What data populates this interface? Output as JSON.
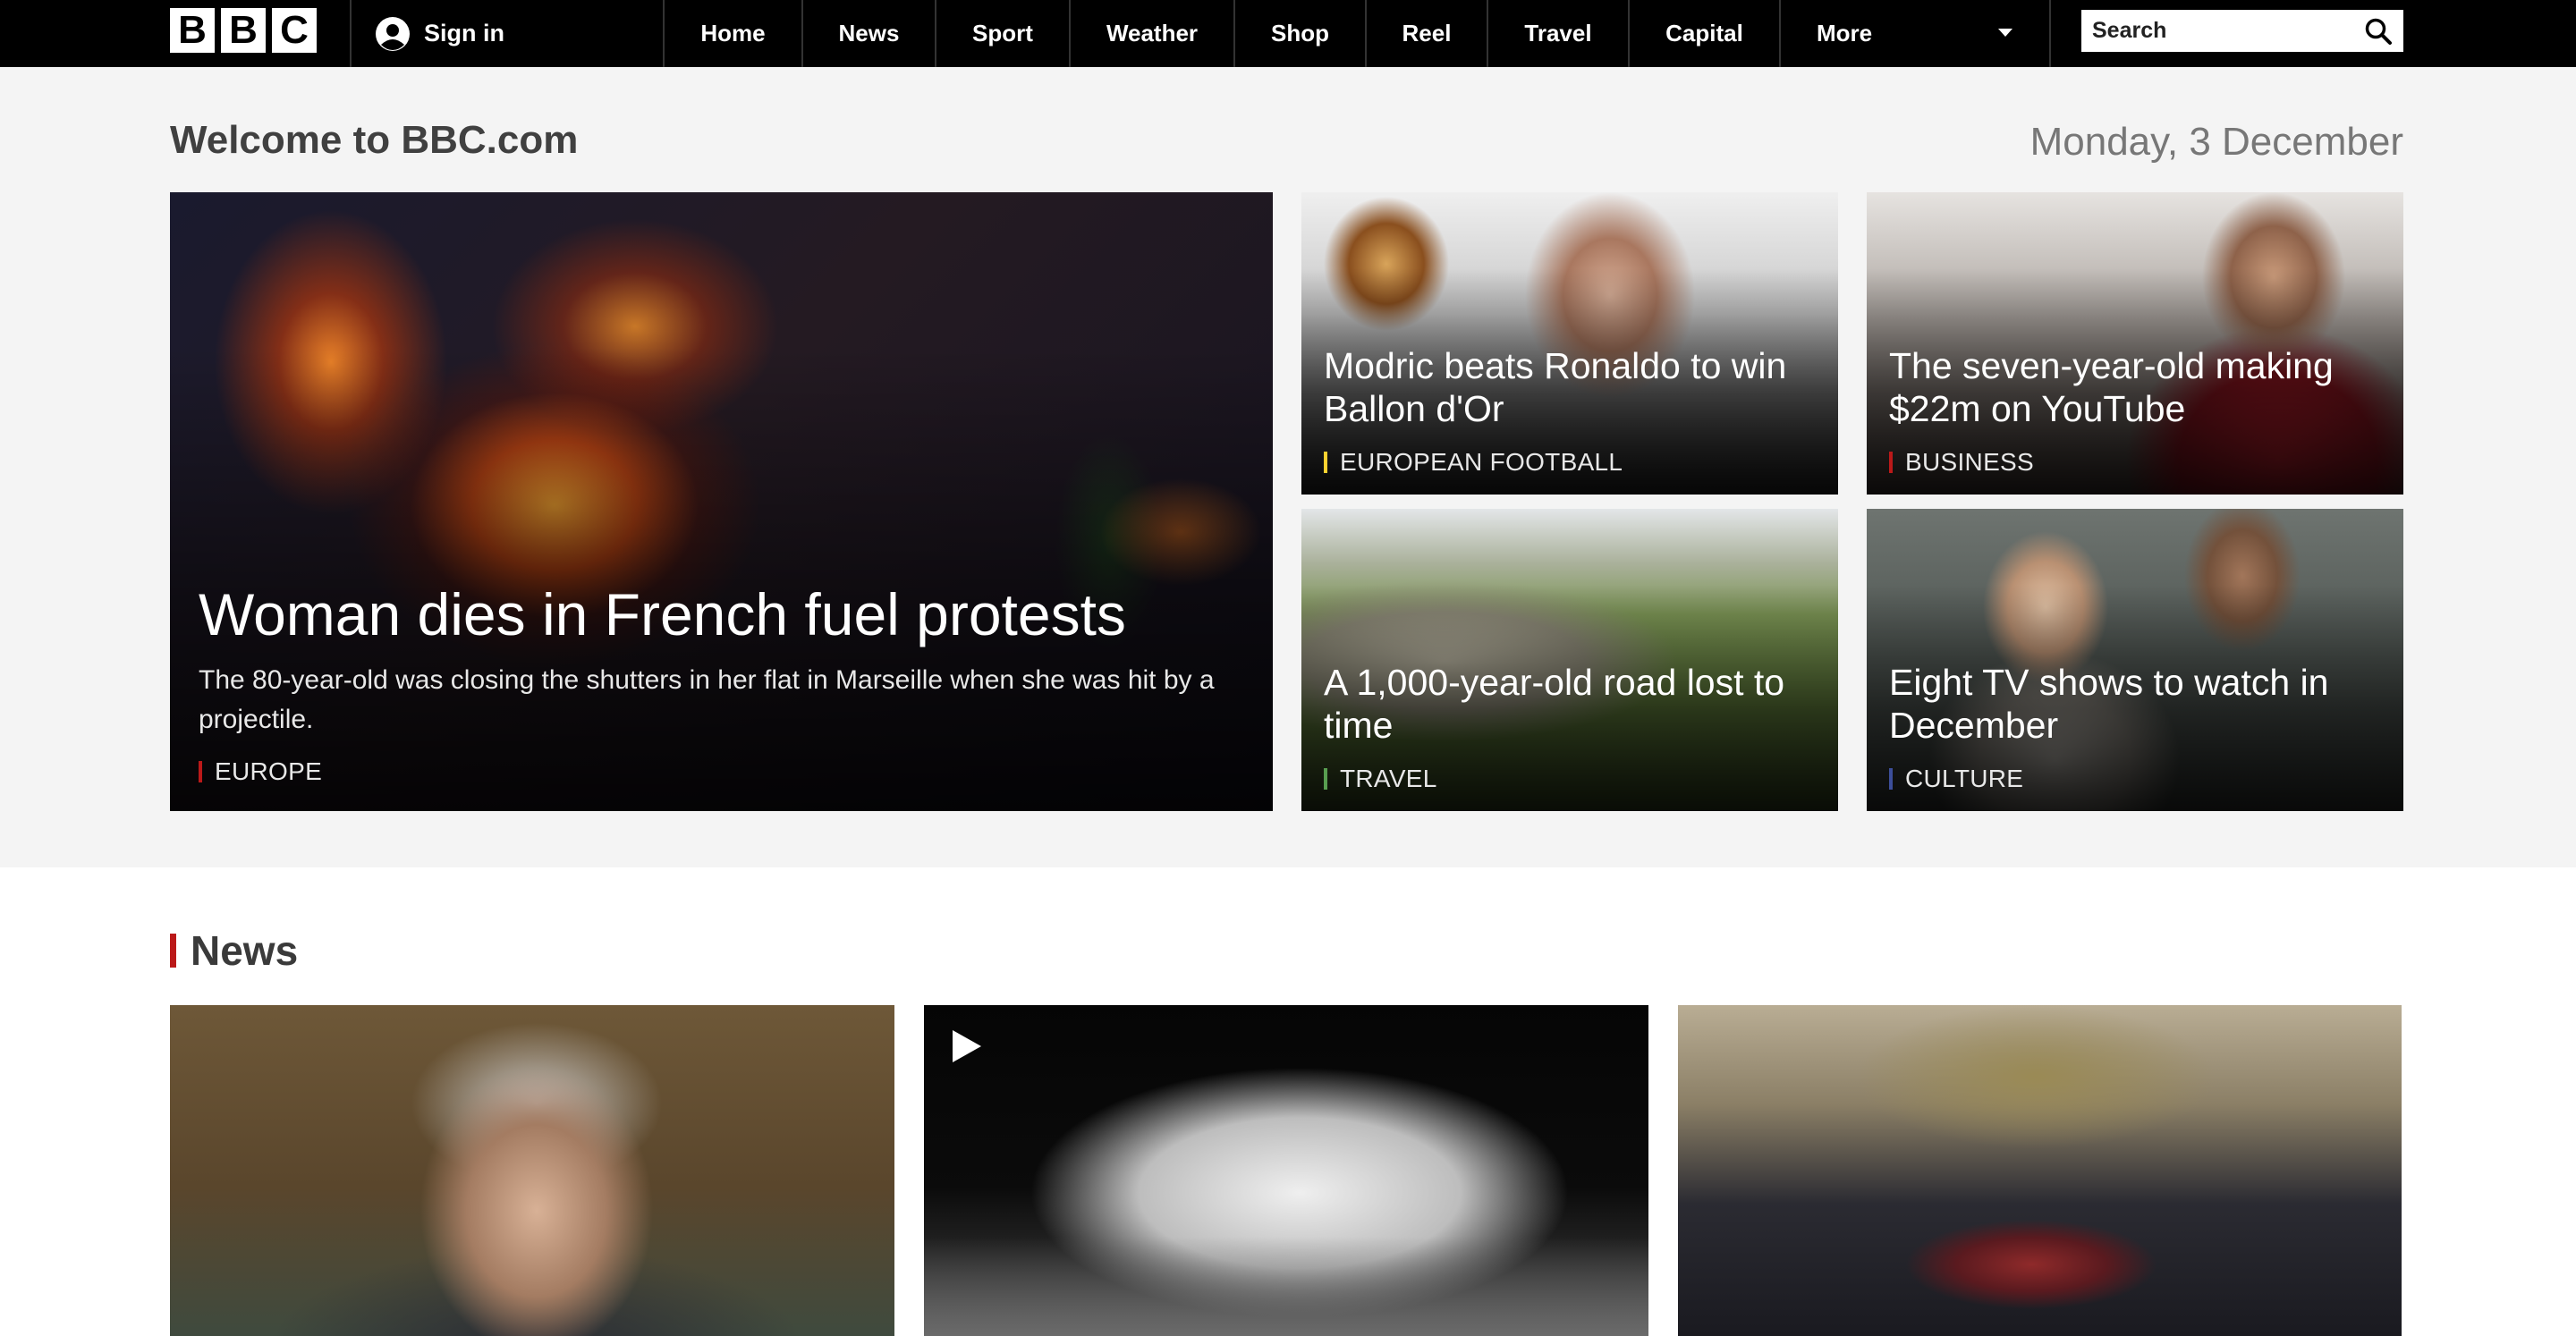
{
  "topbar": {
    "logo_letters": [
      "B",
      "B",
      "C"
    ],
    "signin_label": "Sign in",
    "nav": [
      "Home",
      "News",
      "Sport",
      "Weather",
      "Shop",
      "Reel",
      "Travel",
      "Capital",
      "More"
    ],
    "search_placeholder": "Search",
    "icons": {
      "avatar": "user-avatar-icon",
      "more": "chevron-down-icon",
      "search": "search-icon"
    }
  },
  "welcome": {
    "title": "Welcome to BBC.com",
    "date": "Monday, 3 December"
  },
  "hero": {
    "main": {
      "title": "Woman dies in French fuel protests",
      "summary": "The 80-year-old was closing the shutters in her flat in Marseille when she was hit by a projectile.",
      "tag": "EUROPE",
      "tag_color": "#bb1919"
    },
    "cards": [
      {
        "title": "Modric beats Ronaldo to win Ballon d'Or",
        "tag": "EUROPEAN FOOTBALL",
        "tag_color": "#ffd230"
      },
      {
        "title": "The seven-year-old making $22m on YouTube",
        "tag": "BUSINESS",
        "tag_color": "#bb1919"
      },
      {
        "title": "A 1,000-year-old road lost to time",
        "tag": "TRAVEL",
        "tag_color": "#589e50"
      },
      {
        "title": "Eight TV shows to watch in December",
        "tag": "CULTURE",
        "tag_color": "#3c4e9a"
      }
    ]
  },
  "news": {
    "heading": "News",
    "accent_color": "#bb1919",
    "play_icon": "play-icon"
  }
}
